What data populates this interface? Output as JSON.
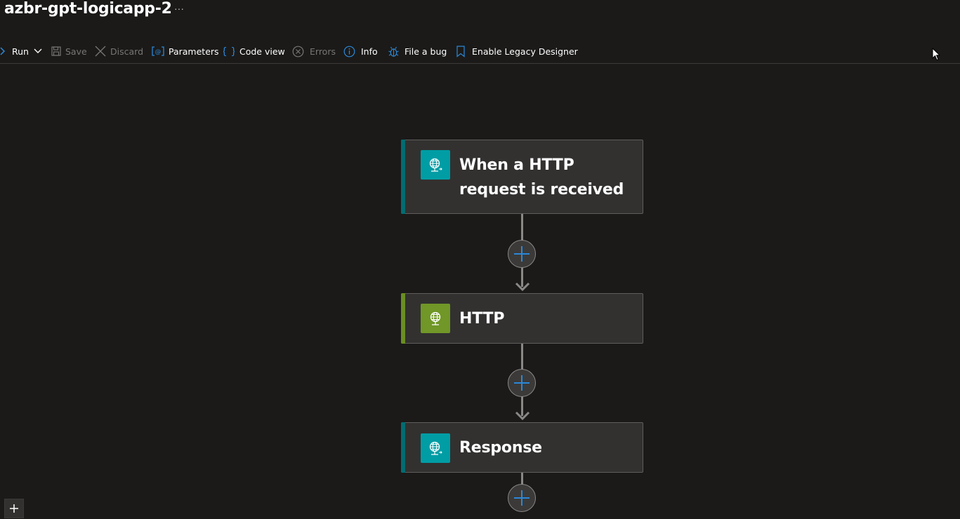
{
  "app": {
    "title": "azbr-gpt-logicapp-2",
    "more_label": "···"
  },
  "toolbar": {
    "run": "Run",
    "save": "Save",
    "discard": "Discard",
    "parameters": "Parameters",
    "code_view": "Code view",
    "errors": "Errors",
    "info": "Info",
    "file_bug": "File a bug",
    "legacy": "Enable Legacy Designer"
  },
  "workflow": {
    "steps": [
      {
        "title": "When a HTTP request is received",
        "icon": "http-request-icon",
        "accent": "#036c70",
        "icon_bg": "#009da5"
      },
      {
        "title": "HTTP",
        "icon": "http-globe-icon",
        "accent": "#6a8e23",
        "icon_bg": "#709727"
      },
      {
        "title": "Response",
        "icon": "http-response-icon",
        "accent": "#036c70",
        "icon_bg": "#009da5"
      }
    ]
  },
  "colors": {
    "background": "#1b1a19",
    "card": "#323130",
    "accent_blue": "#2b88d8"
  }
}
